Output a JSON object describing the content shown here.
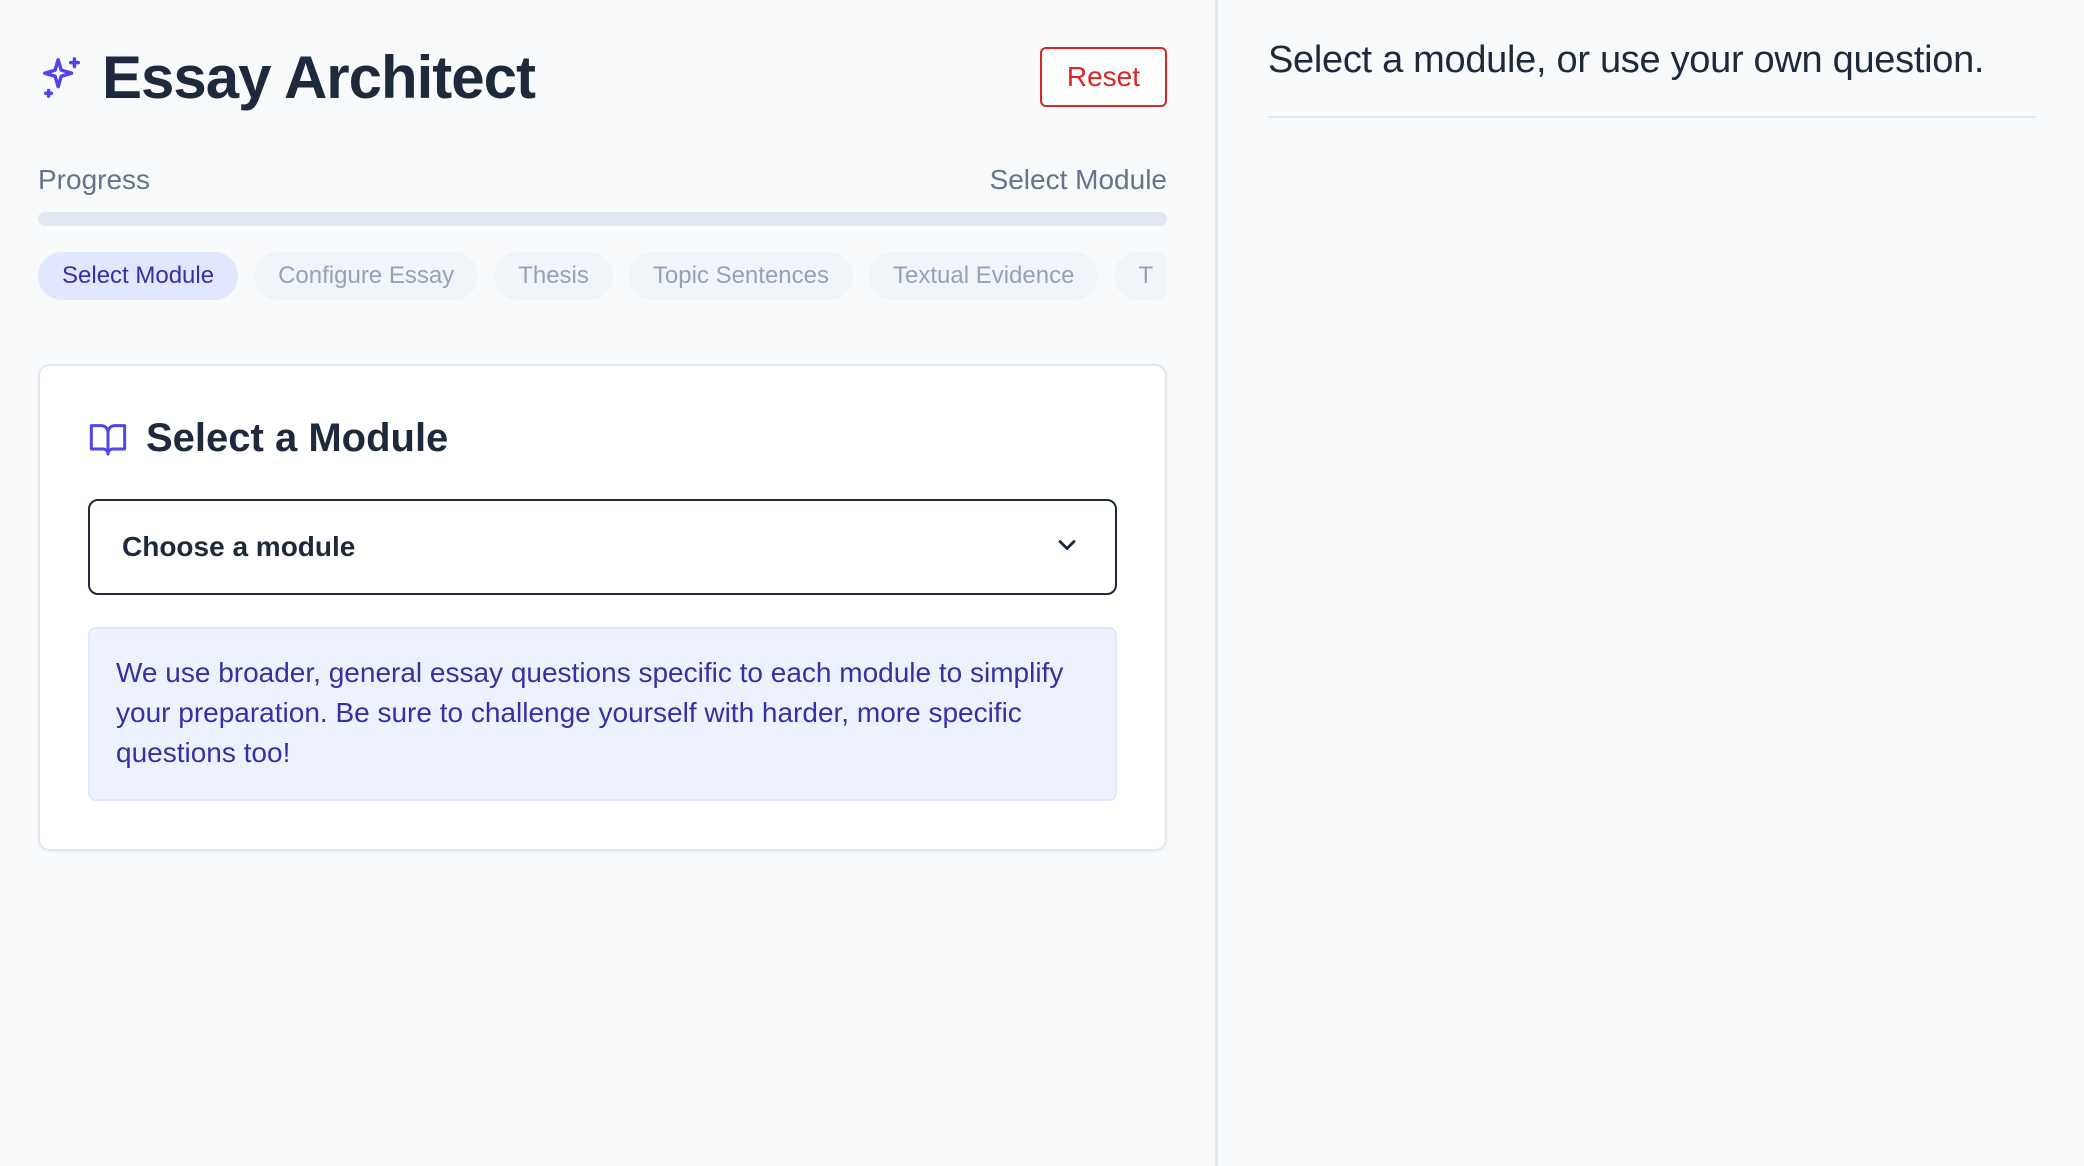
{
  "app": {
    "title": "Essay Architect",
    "reset_label": "Reset",
    "accent_color": "#4f46e5",
    "danger_color": "#dc2626"
  },
  "progress": {
    "label": "Progress",
    "current_step_label": "Select Module",
    "percent": 0
  },
  "steps": [
    {
      "label": "Select Module",
      "active": true
    },
    {
      "label": "Configure Essay",
      "active": false
    },
    {
      "label": "Thesis",
      "active": false
    },
    {
      "label": "Topic Sentences",
      "active": false
    },
    {
      "label": "Textual Evidence",
      "active": false
    },
    {
      "label": "T",
      "active": false
    }
  ],
  "module_card": {
    "title": "Select a Module",
    "icon": "book-open-icon",
    "select_value": "Choose a module",
    "info_text": "We use broader, general essay questions specific to each module to simplify your preparation. Be sure to challenge yourself with harder, more specific questions too!"
  },
  "preview": {
    "heading": "Select a module, or use your own question."
  }
}
